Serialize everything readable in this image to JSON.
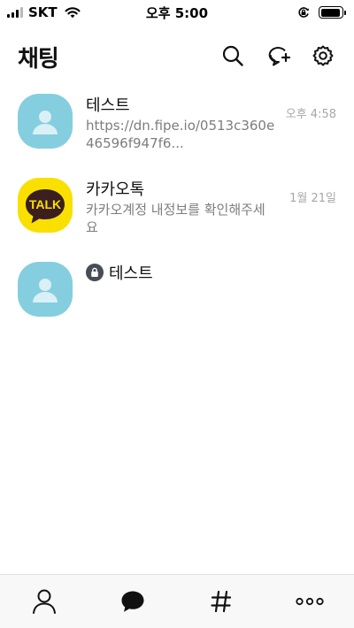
{
  "status_bar": {
    "carrier": "SKT",
    "time": "오후 5:00",
    "signal_bars_active": 3,
    "signal_bars_total": 4,
    "battery_level": 0.95
  },
  "header": {
    "title": "채팅",
    "icons": [
      "search-icon",
      "new-chat-icon",
      "settings-icon"
    ]
  },
  "chats": [
    {
      "name": "테스트",
      "preview": "https://dn.fipe.io/0513c360e46596f947f6...",
      "time": "오후 4:58",
      "avatar": "default-profile",
      "locked": false
    },
    {
      "name": "카카오톡",
      "preview": "카카오계정 내정보를 확인해주세요",
      "time": "1월 21일",
      "avatar": "kakaotalk-logo",
      "logo_text": "TALK",
      "locked": false
    },
    {
      "name": "테스트",
      "preview": "",
      "time": "",
      "avatar": "default-profile",
      "locked": true
    }
  ],
  "tabs": [
    "friends-tab",
    "chats-tab",
    "openchat-tab",
    "more-tab"
  ],
  "colors": {
    "avatar_default": "#84cee0",
    "kakao_yellow": "#f9e000",
    "kakao_brown": "#3b1e1e",
    "secondary_text": "#7d7d7d",
    "time_text": "#a7a7a7"
  }
}
